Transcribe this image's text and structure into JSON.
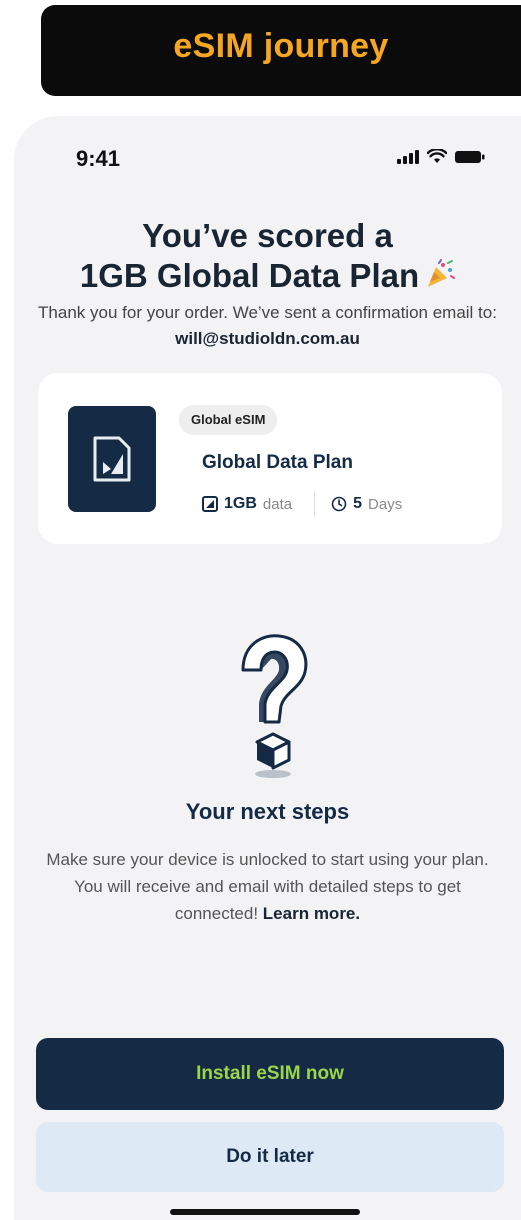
{
  "banner": {
    "title": "eSIM journey",
    "color": "#f5a623"
  },
  "status_bar": {
    "time": "9:41",
    "icons": [
      "signal-icon",
      "wifi-icon",
      "battery-icon"
    ]
  },
  "confirmation": {
    "heading_line1": "You’ve scored a",
    "heading_line2": "1GB Global Data Plan",
    "heading_emoji": "party-popper-icon",
    "message": "Thank you for your order. We’ve sent a confirmation email to:",
    "email": "will@studioldn.com.au"
  },
  "plan_card": {
    "icon": "sim-card-icon",
    "tag": "Global eSIM",
    "name": "Global Data Plan",
    "data_amount": "1GB",
    "data_unit": "data",
    "duration_amount": "5",
    "duration_unit": "Days"
  },
  "next_steps": {
    "illustration": "question-mark-icon",
    "title": "Your next steps",
    "body": "Make sure your device is unlocked to start using your plan. You will receive and email with detailed steps to get connected!",
    "learn_more": "Learn more."
  },
  "actions": {
    "primary_label": "Install eSIM now",
    "secondary_label": "Do it later"
  },
  "colors": {
    "navy": "#142a45",
    "accent_green": "#9bd54a",
    "secondary_bg": "#dde9f5",
    "screen_bg": "#f3f3f5"
  }
}
